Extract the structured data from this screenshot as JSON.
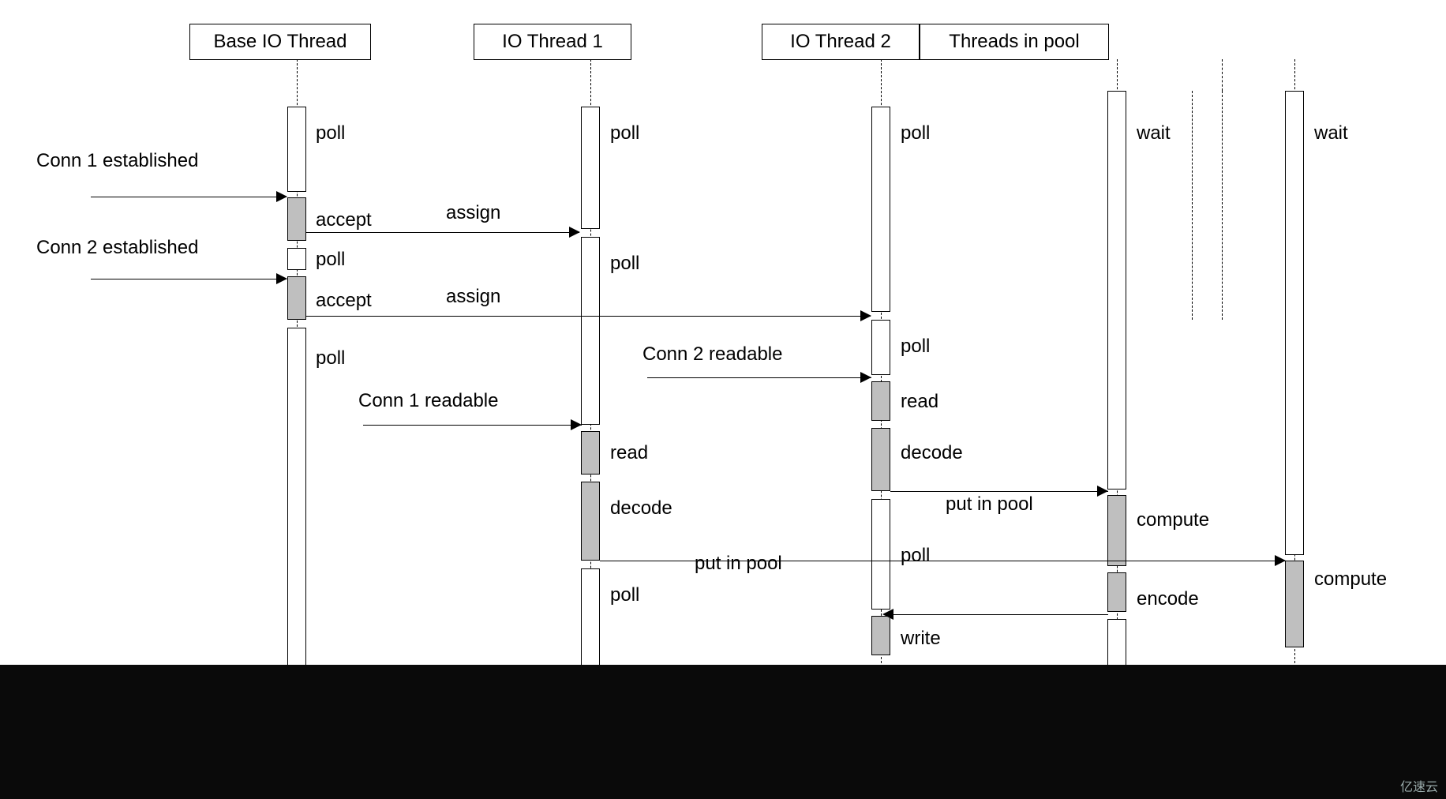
{
  "participants": {
    "base": "Base IO Thread",
    "io1": "IO Thread 1",
    "io2": "IO Thread 2",
    "pool": "Threads in pool"
  },
  "events": {
    "conn1_est": "Conn 1 established",
    "conn2_est": "Conn 2 established",
    "conn1_readable": "Conn 1 readable",
    "conn2_readable": "Conn 2 readable"
  },
  "actions": {
    "poll": "poll",
    "wait": "wait",
    "accept": "accept",
    "assign": "assign",
    "read": "read",
    "decode": "decode",
    "put_in_pool": "put in pool",
    "compute": "compute",
    "encode": "encode",
    "write": "write"
  },
  "watermark": "亿速云"
}
